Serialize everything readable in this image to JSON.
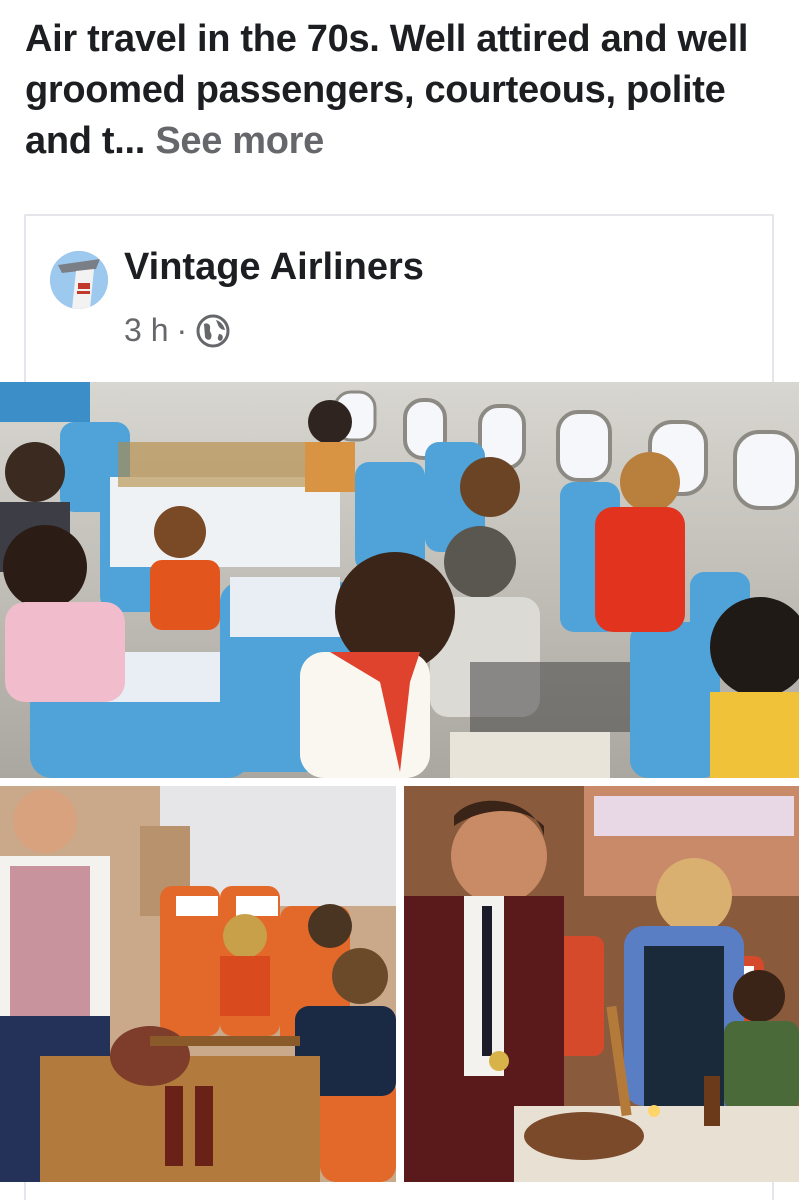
{
  "post": {
    "text": "Air travel in the 70s. Well attired and well groomed passengers, courteous, polite and t...",
    "see_more": "See more"
  },
  "shared_post": {
    "page_name": "Vintage Airliners",
    "time": "3 h",
    "separator": "·",
    "audience_icon": "globe-icon"
  },
  "photos": [
    {
      "name": "cabin-meal-service-photo"
    },
    {
      "name": "steward-carving-photo"
    },
    {
      "name": "steward-stewardess-serving-photo"
    }
  ],
  "colors": {
    "text_primary": "#1c1e21",
    "text_secondary": "#65676b",
    "border": "#e4e6eb",
    "seat_blue": "#4fa3d8"
  }
}
